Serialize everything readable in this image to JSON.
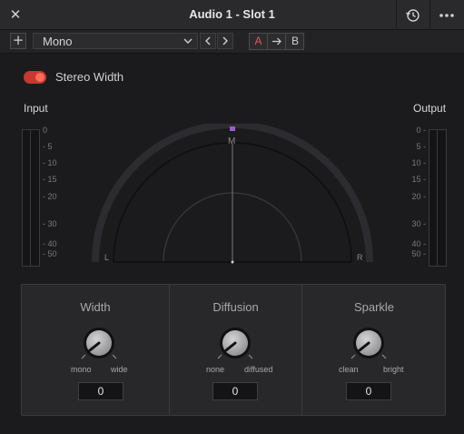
{
  "window": {
    "title": "Audio 1 - Slot 1"
  },
  "toolbar": {
    "preset": "Mono",
    "a_label": "A",
    "b_label": "B"
  },
  "stereo_width_toggle": {
    "label": "Stereo Width",
    "enabled": true
  },
  "meters": {
    "input_label": "Input",
    "output_label": "Output",
    "scale": [
      "0",
      "- 5",
      "- 10",
      "- 15",
      "- 20",
      "- 30",
      "- 40",
      "- 50"
    ],
    "scale_right": [
      "0 -",
      "5 -",
      "10 -",
      "15 -",
      "20 -",
      "30 -",
      "40 -",
      "50 -"
    ]
  },
  "scope": {
    "mid_label": "M",
    "left_label": "L",
    "right_label": "R"
  },
  "controls": [
    {
      "title": "Width",
      "min_label": "mono",
      "max_label": "wide",
      "value": "0"
    },
    {
      "title": "Diffusion",
      "min_label": "none",
      "max_label": "diffused",
      "value": "0"
    },
    {
      "title": "Sparkle",
      "min_label": "clean",
      "max_label": "bright",
      "value": "0"
    }
  ],
  "colors": {
    "accent_red": "#e25a4e",
    "toggle_on": "#c8382e",
    "marker_purple": "#9a5bd6"
  }
}
